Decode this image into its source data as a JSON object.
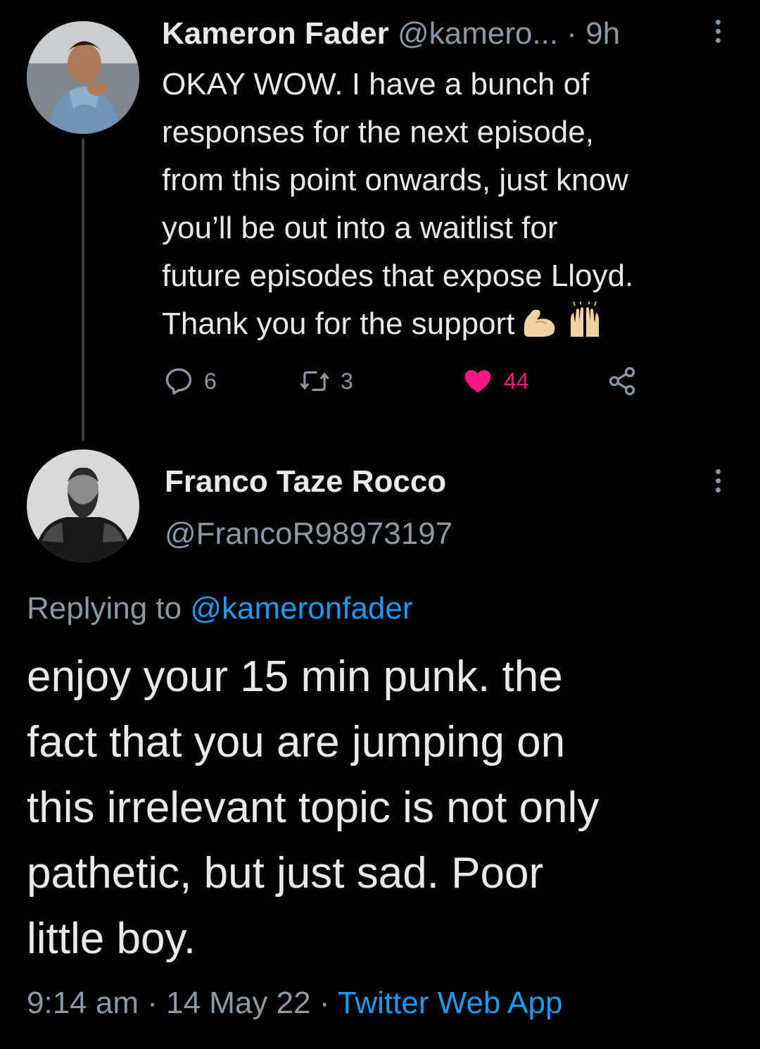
{
  "tweet1": {
    "author_name": "Kameron Fader",
    "author_handle": "@kamero...",
    "separator": "·",
    "time": "9h",
    "text": "OKAY WOW. I have a bunch of\nresponses for the next episode,\nfrom this point onwards, just know\nyou’ll be out into a waitlist for\nfuture episodes that expose Lloyd.\nThank you for the support",
    "emojis": [
      "flexed-biceps-icon",
      "raising-hands-icon"
    ],
    "reply_count": "6",
    "retweet_count": "3",
    "like_count": "44",
    "like_color": "#f91880",
    "liked": true
  },
  "tweet2": {
    "author_name": "Franco Taze Rocco",
    "author_handle": "@FrancoR98973197",
    "replying_prefix": "Replying to",
    "replying_handle": "@kameronfader",
    "text": "enjoy your 15 min punk. the\nfact that you are jumping on\nthis irrelevant topic is not only\npathetic, but just sad. Poor\nlittle boy.",
    "time": "9:14 am",
    "date": "14 May 22",
    "separator": "·",
    "source": "Twitter Web App"
  },
  "colors": {
    "background": "#000000",
    "text": "#e7e9ea",
    "muted": "#8b98a5",
    "link": "#1d9bf0",
    "thread_line": "#3a3d40"
  }
}
